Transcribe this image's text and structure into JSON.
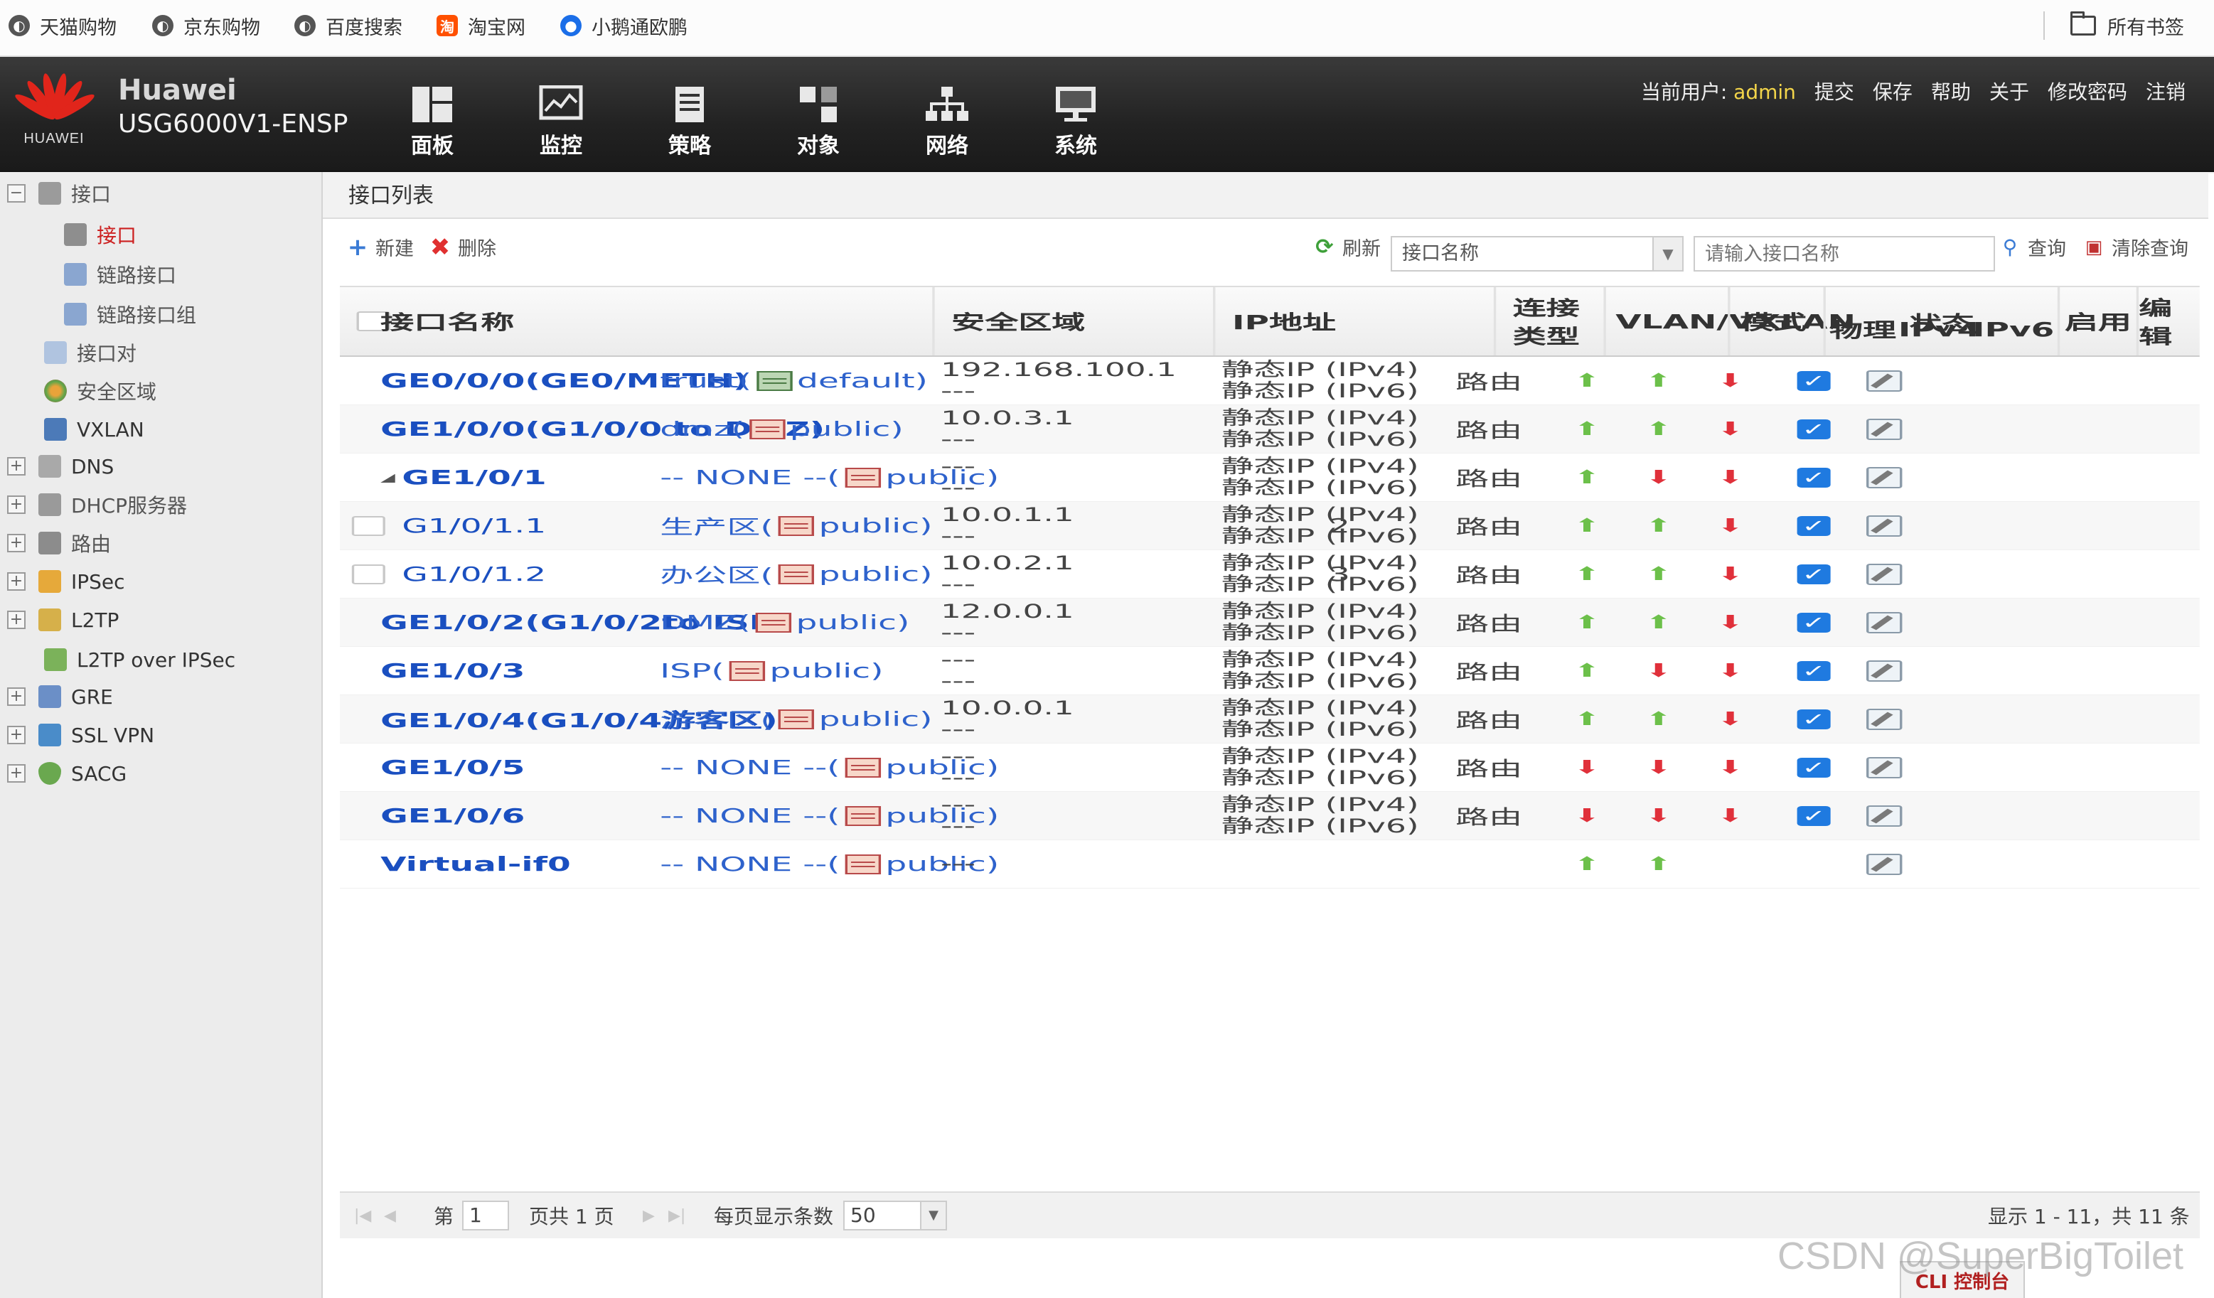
{
  "bookmarks": {
    "items": [
      {
        "label": "天猫购物",
        "icon": "globe-icon"
      },
      {
        "label": "京东购物",
        "icon": "globe-icon"
      },
      {
        "label": "百度搜索",
        "icon": "globe-icon"
      },
      {
        "label": "淘宝网",
        "icon": "taobao-icon",
        "icon_text": "淘"
      },
      {
        "label": "小鹅通欧鹏",
        "icon": "bird-icon"
      }
    ],
    "all_label": "所有书签"
  },
  "header": {
    "logo_text": "HUAWEI",
    "brand": "Huawei",
    "model": "USG6000V1-ENSP",
    "nav": [
      {
        "label": "面板",
        "icon": "dashboard-icon"
      },
      {
        "label": "监控",
        "icon": "monitor-icon"
      },
      {
        "label": "策略",
        "icon": "policy-icon"
      },
      {
        "label": "对象",
        "icon": "object-icon"
      },
      {
        "label": "网络",
        "icon": "network-icon"
      },
      {
        "label": "系统",
        "icon": "system-icon"
      }
    ],
    "user_prefix": "当前用户:",
    "user_name": "admin",
    "actions": [
      "提交",
      "保存",
      "帮助",
      "关于",
      "修改密码",
      "注销"
    ]
  },
  "sidebar": {
    "items": [
      {
        "label": "接口",
        "toggle": "−",
        "icon": "interface-icon"
      },
      {
        "label": "接口",
        "toggle": "",
        "icon": "interface-icon",
        "selected": true
      },
      {
        "label": "链路接口",
        "toggle": "",
        "icon": "link-icon"
      },
      {
        "label": "链路接口组",
        "toggle": "",
        "icon": "link-group-icon"
      },
      {
        "label": "接口对",
        "toggle": "",
        "icon": "pair-icon"
      },
      {
        "label": "安全区域",
        "toggle": "",
        "icon": "zone-icon"
      },
      {
        "label": "VXLAN",
        "toggle": "",
        "icon": "vxlan-icon"
      },
      {
        "label": "DNS",
        "toggle": "+",
        "icon": "dns-icon"
      },
      {
        "label": "DHCP服务器",
        "toggle": "+",
        "icon": "dhcp-icon"
      },
      {
        "label": "路由",
        "toggle": "+",
        "icon": "route-icon"
      },
      {
        "label": "IPSec",
        "toggle": "+",
        "icon": "ipsec-icon"
      },
      {
        "label": "L2TP",
        "toggle": "+",
        "icon": "l2tp-icon"
      },
      {
        "label": "L2TP over IPSec",
        "toggle": "",
        "icon": "l2tp-ipsec-icon"
      },
      {
        "label": "GRE",
        "toggle": "+",
        "icon": "gre-icon"
      },
      {
        "label": "SSL VPN",
        "toggle": "+",
        "icon": "sslvpn-icon"
      },
      {
        "label": "SACG",
        "toggle": "+",
        "icon": "sacg-icon"
      }
    ]
  },
  "panel": {
    "title": "接口列表",
    "toolbar": {
      "new_label": "新建",
      "delete_label": "删除",
      "refresh_label": "刷新",
      "select_value": "接口名称",
      "search_placeholder": "请输入接口名称",
      "query_label": "查询",
      "clear_label": "清除查询"
    },
    "columns": {
      "name": "接口名称",
      "zone": "安全区域",
      "ip": "IP地址",
      "conn": "连接类型",
      "vlan": "VLAN/VXLAN",
      "mode": "模式",
      "status": "状态",
      "phys": "物理",
      "ipv4": "IPv4",
      "ipv6": "IPv6",
      "enable": "启用",
      "edit": "编辑"
    },
    "rows": [
      {
        "name": "GE0/0/0(GE0/METH)",
        "zone_name": "trust(",
        "zone_vsys": "default)",
        "zone_type": "trust",
        "ip": [
          "192.168.100.1",
          "---"
        ],
        "conn": [
          "静态IP (IPv4)",
          "静态IP (IPv6)"
        ],
        "vlan": "",
        "mode": "路由",
        "phys": "up",
        "ipv4": "up",
        "ipv6": "down",
        "enabled": true
      },
      {
        "name": "GE1/0/0(G1/0/0 to DMZ)",
        "zone_name": "dmz(",
        "zone_vsys": "public)",
        "zone_type": "untrust",
        "ip": [
          "10.0.3.1",
          "---"
        ],
        "conn": [
          "静态IP (IPv4)",
          "静态IP (IPv6)"
        ],
        "vlan": "",
        "mode": "路由",
        "phys": "up",
        "ipv4": "up",
        "ipv6": "down",
        "enabled": true
      },
      {
        "name": "GE1/0/1",
        "zone_name": "-- NONE --(",
        "zone_vsys": "public)",
        "zone_type": "untrust",
        "ip": [
          "---",
          "---"
        ],
        "conn": [
          "静态IP (IPv4)",
          "静态IP (IPv6)"
        ],
        "vlan": "",
        "mode": "路由",
        "phys": "up",
        "ipv4": "down",
        "ipv6": "down",
        "enabled": true,
        "expand": "◢"
      },
      {
        "name": "G1/0/1.1",
        "zone_name": "生产区(",
        "zone_vsys": "public)",
        "zone_type": "untrust",
        "ip": [
          "10.0.1.1",
          "---"
        ],
        "conn": [
          "静态IP (IPv4)",
          "静态IP (IPv6)"
        ],
        "vlan": "2",
        "mode": "路由",
        "phys": "up",
        "ipv4": "up",
        "ipv6": "down",
        "enabled": true,
        "sub": true
      },
      {
        "name": "G1/0/1.2",
        "zone_name": "办公区(",
        "zone_vsys": "public)",
        "zone_type": "untrust",
        "ip": [
          "10.0.2.1",
          "---"
        ],
        "conn": [
          "静态IP (IPv4)",
          "静态IP (IPv6)"
        ],
        "vlan": "3",
        "mode": "路由",
        "phys": "up",
        "ipv4": "up",
        "ipv6": "down",
        "enabled": true,
        "sub": true
      },
      {
        "name": "GE1/0/2(G1/0/2to ISP)",
        "zone_name": "DMZ(",
        "zone_vsys": "public)",
        "zone_type": "untrust",
        "ip": [
          "12.0.0.1",
          "---"
        ],
        "conn": [
          "静态IP (IPv4)",
          "静态IP (IPv6)"
        ],
        "vlan": "",
        "mode": "路由",
        "phys": "up",
        "ipv4": "up",
        "ipv6": "down",
        "enabled": true
      },
      {
        "name": "GE1/0/3",
        "zone_name": "ISP(",
        "zone_vsys": "public)",
        "zone_type": "untrust",
        "ip": [
          "---",
          "---"
        ],
        "conn": [
          "静态IP (IPv4)",
          "静态IP (IPv6)"
        ],
        "vlan": "",
        "mode": "路由",
        "phys": "up",
        "ipv4": "down",
        "ipv6": "down",
        "enabled": true
      },
      {
        "name": "GE1/0/4(G1/0/4游客区)",
        "zone_name": "游客区(",
        "zone_vsys": "public)",
        "zone_type": "untrust",
        "ip": [
          "10.0.0.1",
          "---"
        ],
        "conn": [
          "静态IP (IPv4)",
          "静态IP (IPv6)"
        ],
        "vlan": "",
        "mode": "路由",
        "phys": "up",
        "ipv4": "up",
        "ipv6": "down",
        "enabled": true
      },
      {
        "name": "GE1/0/5",
        "zone_name": "-- NONE --(",
        "zone_vsys": "public)",
        "zone_type": "untrust",
        "ip": [
          "---",
          "---"
        ],
        "conn": [
          "静态IP (IPv4)",
          "静态IP (IPv6)"
        ],
        "vlan": "",
        "mode": "路由",
        "phys": "down",
        "ipv4": "down",
        "ipv6": "down",
        "enabled": true
      },
      {
        "name": "GE1/0/6",
        "zone_name": "-- NONE --(",
        "zone_vsys": "public)",
        "zone_type": "untrust",
        "ip": [
          "---",
          "---"
        ],
        "conn": [
          "静态IP (IPv4)",
          "静态IP (IPv6)"
        ],
        "vlan": "",
        "mode": "路由",
        "phys": "down",
        "ipv4": "down",
        "ipv6": "down",
        "enabled": true
      },
      {
        "name": "Virtual-if0",
        "zone_name": "-- NONE --(",
        "zone_vsys": "public)",
        "zone_type": "untrust",
        "ip": [
          "---"
        ],
        "conn": [],
        "vlan": "",
        "mode": "",
        "phys": "up",
        "ipv4": "up",
        "ipv6": "",
        "enabled": null
      }
    ],
    "pager": {
      "page_prefix": "第",
      "page_value": "1",
      "page_suffix": "页共 1 页",
      "per_page_label": "每页显示条数",
      "per_page_value": "50",
      "summary": "显示 1 - 11，共 11 条"
    }
  },
  "cli_label": "CLI 控制台",
  "watermark": "CSDN @SuperBigToilet",
  "colors": {
    "up": "#6cc04a",
    "down": "#e0303a",
    "link": "#1a4fc0",
    "accent": "#1f7ae0"
  }
}
